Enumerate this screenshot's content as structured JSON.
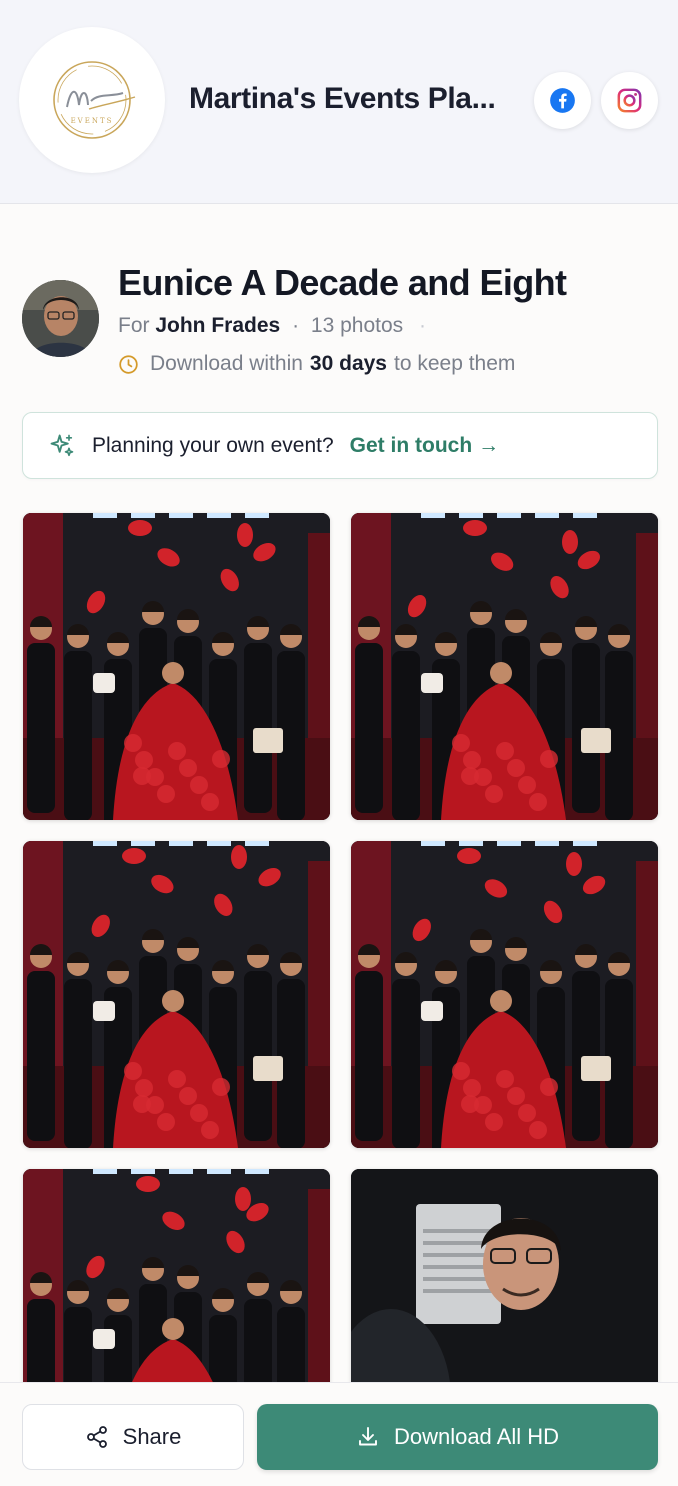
{
  "brand": {
    "name": "Martina's Events Pla...",
    "logo_script": "Martina",
    "logo_sub": "EVENTS",
    "gold": "#c9a65a"
  },
  "social": {
    "facebook_icon": "facebook-icon",
    "instagram_icon": "instagram-icon"
  },
  "event": {
    "title": "Eunice A Decade and Eight",
    "for_label": "For",
    "host": "John Frades",
    "separator": "·",
    "photo_count": "13 photos",
    "trailing_dot": "·",
    "download_prefix": "Download within",
    "download_days": "30 days",
    "download_suffix": "to keep them"
  },
  "promo": {
    "text": "Planning your own event?",
    "link_label": "Get in touch",
    "arrow": "→",
    "accent": "#2e7d67"
  },
  "photos": [
    {
      "kind": "group"
    },
    {
      "kind": "group"
    },
    {
      "kind": "group"
    },
    {
      "kind": "group"
    },
    {
      "kind": "group"
    },
    {
      "kind": "portrait"
    }
  ],
  "actions": {
    "share_label": "Share",
    "download_label": "Download All HD",
    "primary_color": "#3d8a77"
  }
}
